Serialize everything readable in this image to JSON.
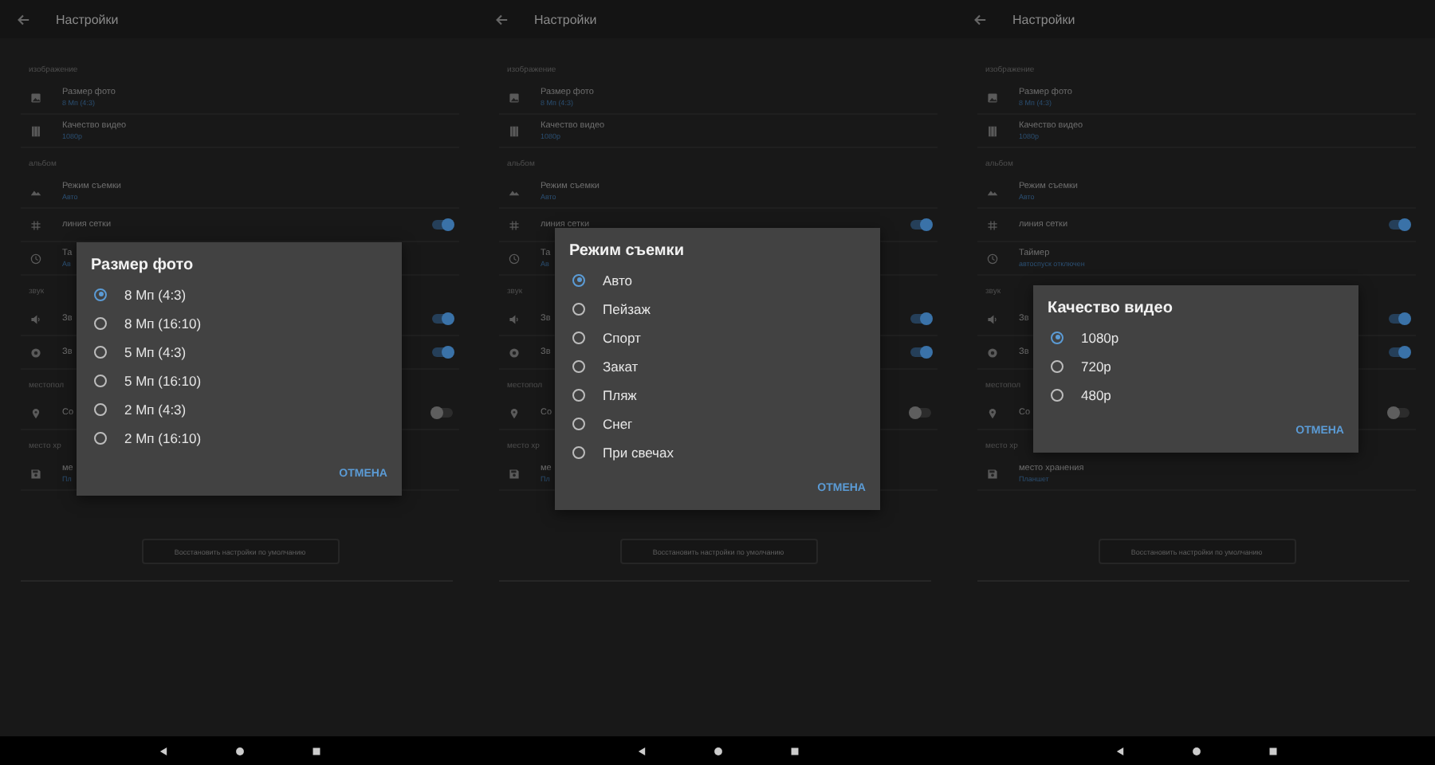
{
  "panels": [
    {
      "title": "Настройки",
      "sections": [
        {
          "header": "изображение",
          "items": [
            {
              "kind": "value",
              "title": "Размер фото",
              "subtitle": "8 Мп (4:3)"
            },
            {
              "kind": "value",
              "title": "Качество видео",
              "subtitle": "1080p"
            }
          ]
        },
        {
          "header": "альбом",
          "items": [
            {
              "kind": "value",
              "title": "Режим съемки",
              "subtitle": "Авто"
            },
            {
              "kind": "switch",
              "title": "линия сетки",
              "on": true
            },
            {
              "kind": "value",
              "title": "Та",
              "subtitle": "Ав"
            }
          ]
        },
        {
          "header": "звук",
          "items": [
            {
              "kind": "switch",
              "title": "Зв",
              "on": true
            },
            {
              "kind": "switch",
              "title": "Зв",
              "on": true
            }
          ]
        },
        {
          "header": "местопол",
          "items": [
            {
              "kind": "switch",
              "title": "Со",
              "on": false
            }
          ]
        },
        {
          "header": "место хр",
          "items": [
            {
              "kind": "value",
              "title": "ме",
              "subtitle": "Пл"
            }
          ]
        }
      ],
      "restore_button": "Восстановить настройки по умолчанию",
      "dialog": {
        "title": "Размер фото",
        "options": [
          {
            "label": "8 Мп (4:3)",
            "selected": true
          },
          {
            "label": "8 Мп (16:10)",
            "selected": false
          },
          {
            "label": "5 Мп (4:3)",
            "selected": false
          },
          {
            "label": "5 Мп (16:10)",
            "selected": false
          },
          {
            "label": "2 Мп (4:3)",
            "selected": false
          },
          {
            "label": "2 Мп (16:10)",
            "selected": false
          }
        ],
        "cancel": "ОТМЕНА"
      }
    },
    {
      "title": "Настройки",
      "sections": [
        {
          "header": "изображение",
          "items": [
            {
              "kind": "value",
              "title": "Размер фото",
              "subtitle": "8 Мп (4:3)"
            },
            {
              "kind": "value",
              "title": "Качество видео",
              "subtitle": "1080p"
            }
          ]
        },
        {
          "header": "альбом",
          "items": [
            {
              "kind": "value",
              "title": "Режим съемки",
              "subtitle": "Авто"
            },
            {
              "kind": "switch",
              "title": "линия сетки",
              "on": true
            },
            {
              "kind": "value",
              "title": "Та",
              "subtitle": "Ав"
            }
          ]
        },
        {
          "header": "звук",
          "items": [
            {
              "kind": "switch",
              "title": "Зв",
              "on": true
            },
            {
              "kind": "switch",
              "title": "Зв",
              "on": true
            }
          ]
        },
        {
          "header": "местопол",
          "items": [
            {
              "kind": "switch",
              "title": "Со",
              "on": false
            }
          ]
        },
        {
          "header": "место хр",
          "items": [
            {
              "kind": "value",
              "title": "ме",
              "subtitle": "Пл"
            }
          ]
        }
      ],
      "restore_button": "Восстановить настройки по умолчанию",
      "dialog": {
        "title": "Режим съемки",
        "options": [
          {
            "label": "Авто",
            "selected": true
          },
          {
            "label": "Пейзаж",
            "selected": false
          },
          {
            "label": "Спорт",
            "selected": false
          },
          {
            "label": "Закат",
            "selected": false
          },
          {
            "label": "Пляж",
            "selected": false
          },
          {
            "label": "Снег",
            "selected": false
          },
          {
            "label": "При свечах",
            "selected": false
          }
        ],
        "cancel": "ОТМЕНА"
      }
    },
    {
      "title": "Настройки",
      "sections": [
        {
          "header": "изображение",
          "items": [
            {
              "kind": "value",
              "title": "Размер фото",
              "subtitle": "8 Мп (4:3)"
            },
            {
              "kind": "value",
              "title": "Качество видео",
              "subtitle": "1080p"
            }
          ]
        },
        {
          "header": "альбом",
          "items": [
            {
              "kind": "value",
              "title": "Режим съемки",
              "subtitle": "Авто"
            },
            {
              "kind": "switch",
              "title": "линия сетки",
              "on": true
            },
            {
              "kind": "value",
              "title": "Таймер",
              "subtitle": "автоспуск отключен"
            }
          ]
        },
        {
          "header": "звук",
          "items": [
            {
              "kind": "switch",
              "title": "Зв",
              "on": true
            },
            {
              "kind": "switch",
              "title": "Зв",
              "on": true
            }
          ]
        },
        {
          "header": "местопол",
          "items": [
            {
              "kind": "switch",
              "title": "Со",
              "on": false
            }
          ]
        },
        {
          "header": "место хр",
          "items": [
            {
              "kind": "value",
              "title": "место хранения",
              "subtitle": "Планшет"
            }
          ]
        }
      ],
      "restore_button": "Восстановить настройки по умолчанию",
      "dialog": {
        "title": "Качество видео",
        "options": [
          {
            "label": "1080p",
            "selected": true
          },
          {
            "label": "720p",
            "selected": false
          },
          {
            "label": "480p",
            "selected": false
          }
        ],
        "cancel": "ОТМЕНА"
      }
    }
  ]
}
